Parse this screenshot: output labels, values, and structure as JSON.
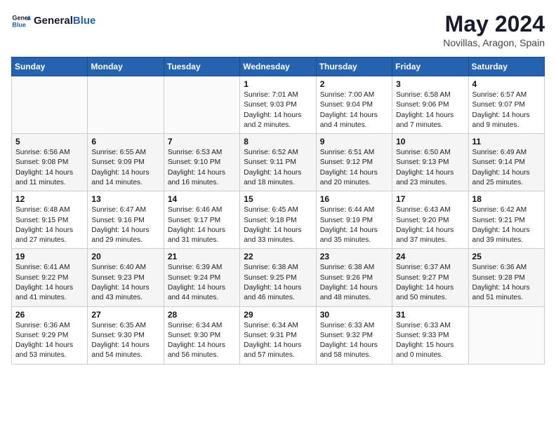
{
  "header": {
    "logo_line1": "General",
    "logo_line2": "Blue",
    "month_title": "May 2024",
    "location": "Novillas, Aragon, Spain"
  },
  "weekdays": [
    "Sunday",
    "Monday",
    "Tuesday",
    "Wednesday",
    "Thursday",
    "Friday",
    "Saturday"
  ],
  "weeks": [
    [
      {
        "day": "",
        "sunrise": "",
        "sunset": "",
        "daylight": ""
      },
      {
        "day": "",
        "sunrise": "",
        "sunset": "",
        "daylight": ""
      },
      {
        "day": "",
        "sunrise": "",
        "sunset": "",
        "daylight": ""
      },
      {
        "day": "1",
        "sunrise": "Sunrise: 7:01 AM",
        "sunset": "Sunset: 9:03 PM",
        "daylight": "Daylight: 14 hours and 2 minutes."
      },
      {
        "day": "2",
        "sunrise": "Sunrise: 7:00 AM",
        "sunset": "Sunset: 9:04 PM",
        "daylight": "Daylight: 14 hours and 4 minutes."
      },
      {
        "day": "3",
        "sunrise": "Sunrise: 6:58 AM",
        "sunset": "Sunset: 9:06 PM",
        "daylight": "Daylight: 14 hours and 7 minutes."
      },
      {
        "day": "4",
        "sunrise": "Sunrise: 6:57 AM",
        "sunset": "Sunset: 9:07 PM",
        "daylight": "Daylight: 14 hours and 9 minutes."
      }
    ],
    [
      {
        "day": "5",
        "sunrise": "Sunrise: 6:56 AM",
        "sunset": "Sunset: 9:08 PM",
        "daylight": "Daylight: 14 hours and 11 minutes."
      },
      {
        "day": "6",
        "sunrise": "Sunrise: 6:55 AM",
        "sunset": "Sunset: 9:09 PM",
        "daylight": "Daylight: 14 hours and 14 minutes."
      },
      {
        "day": "7",
        "sunrise": "Sunrise: 6:53 AM",
        "sunset": "Sunset: 9:10 PM",
        "daylight": "Daylight: 14 hours and 16 minutes."
      },
      {
        "day": "8",
        "sunrise": "Sunrise: 6:52 AM",
        "sunset": "Sunset: 9:11 PM",
        "daylight": "Daylight: 14 hours and 18 minutes."
      },
      {
        "day": "9",
        "sunrise": "Sunrise: 6:51 AM",
        "sunset": "Sunset: 9:12 PM",
        "daylight": "Daylight: 14 hours and 20 minutes."
      },
      {
        "day": "10",
        "sunrise": "Sunrise: 6:50 AM",
        "sunset": "Sunset: 9:13 PM",
        "daylight": "Daylight: 14 hours and 23 minutes."
      },
      {
        "day": "11",
        "sunrise": "Sunrise: 6:49 AM",
        "sunset": "Sunset: 9:14 PM",
        "daylight": "Daylight: 14 hours and 25 minutes."
      }
    ],
    [
      {
        "day": "12",
        "sunrise": "Sunrise: 6:48 AM",
        "sunset": "Sunset: 9:15 PM",
        "daylight": "Daylight: 14 hours and 27 minutes."
      },
      {
        "day": "13",
        "sunrise": "Sunrise: 6:47 AM",
        "sunset": "Sunset: 9:16 PM",
        "daylight": "Daylight: 14 hours and 29 minutes."
      },
      {
        "day": "14",
        "sunrise": "Sunrise: 6:46 AM",
        "sunset": "Sunset: 9:17 PM",
        "daylight": "Daylight: 14 hours and 31 minutes."
      },
      {
        "day": "15",
        "sunrise": "Sunrise: 6:45 AM",
        "sunset": "Sunset: 9:18 PM",
        "daylight": "Daylight: 14 hours and 33 minutes."
      },
      {
        "day": "16",
        "sunrise": "Sunrise: 6:44 AM",
        "sunset": "Sunset: 9:19 PM",
        "daylight": "Daylight: 14 hours and 35 minutes."
      },
      {
        "day": "17",
        "sunrise": "Sunrise: 6:43 AM",
        "sunset": "Sunset: 9:20 PM",
        "daylight": "Daylight: 14 hours and 37 minutes."
      },
      {
        "day": "18",
        "sunrise": "Sunrise: 6:42 AM",
        "sunset": "Sunset: 9:21 PM",
        "daylight": "Daylight: 14 hours and 39 minutes."
      }
    ],
    [
      {
        "day": "19",
        "sunrise": "Sunrise: 6:41 AM",
        "sunset": "Sunset: 9:22 PM",
        "daylight": "Daylight: 14 hours and 41 minutes."
      },
      {
        "day": "20",
        "sunrise": "Sunrise: 6:40 AM",
        "sunset": "Sunset: 9:23 PM",
        "daylight": "Daylight: 14 hours and 43 minutes."
      },
      {
        "day": "21",
        "sunrise": "Sunrise: 6:39 AM",
        "sunset": "Sunset: 9:24 PM",
        "daylight": "Daylight: 14 hours and 44 minutes."
      },
      {
        "day": "22",
        "sunrise": "Sunrise: 6:38 AM",
        "sunset": "Sunset: 9:25 PM",
        "daylight": "Daylight: 14 hours and 46 minutes."
      },
      {
        "day": "23",
        "sunrise": "Sunrise: 6:38 AM",
        "sunset": "Sunset: 9:26 PM",
        "daylight": "Daylight: 14 hours and 48 minutes."
      },
      {
        "day": "24",
        "sunrise": "Sunrise: 6:37 AM",
        "sunset": "Sunset: 9:27 PM",
        "daylight": "Daylight: 14 hours and 50 minutes."
      },
      {
        "day": "25",
        "sunrise": "Sunrise: 6:36 AM",
        "sunset": "Sunset: 9:28 PM",
        "daylight": "Daylight: 14 hours and 51 minutes."
      }
    ],
    [
      {
        "day": "26",
        "sunrise": "Sunrise: 6:36 AM",
        "sunset": "Sunset: 9:29 PM",
        "daylight": "Daylight: 14 hours and 53 minutes."
      },
      {
        "day": "27",
        "sunrise": "Sunrise: 6:35 AM",
        "sunset": "Sunset: 9:30 PM",
        "daylight": "Daylight: 14 hours and 54 minutes."
      },
      {
        "day": "28",
        "sunrise": "Sunrise: 6:34 AM",
        "sunset": "Sunset: 9:30 PM",
        "daylight": "Daylight: 14 hours and 56 minutes."
      },
      {
        "day": "29",
        "sunrise": "Sunrise: 6:34 AM",
        "sunset": "Sunset: 9:31 PM",
        "daylight": "Daylight: 14 hours and 57 minutes."
      },
      {
        "day": "30",
        "sunrise": "Sunrise: 6:33 AM",
        "sunset": "Sunset: 9:32 PM",
        "daylight": "Daylight: 14 hours and 58 minutes."
      },
      {
        "day": "31",
        "sunrise": "Sunrise: 6:33 AM",
        "sunset": "Sunset: 9:33 PM",
        "daylight": "Daylight: 15 hours and 0 minutes."
      },
      {
        "day": "",
        "sunrise": "",
        "sunset": "",
        "daylight": ""
      }
    ]
  ]
}
